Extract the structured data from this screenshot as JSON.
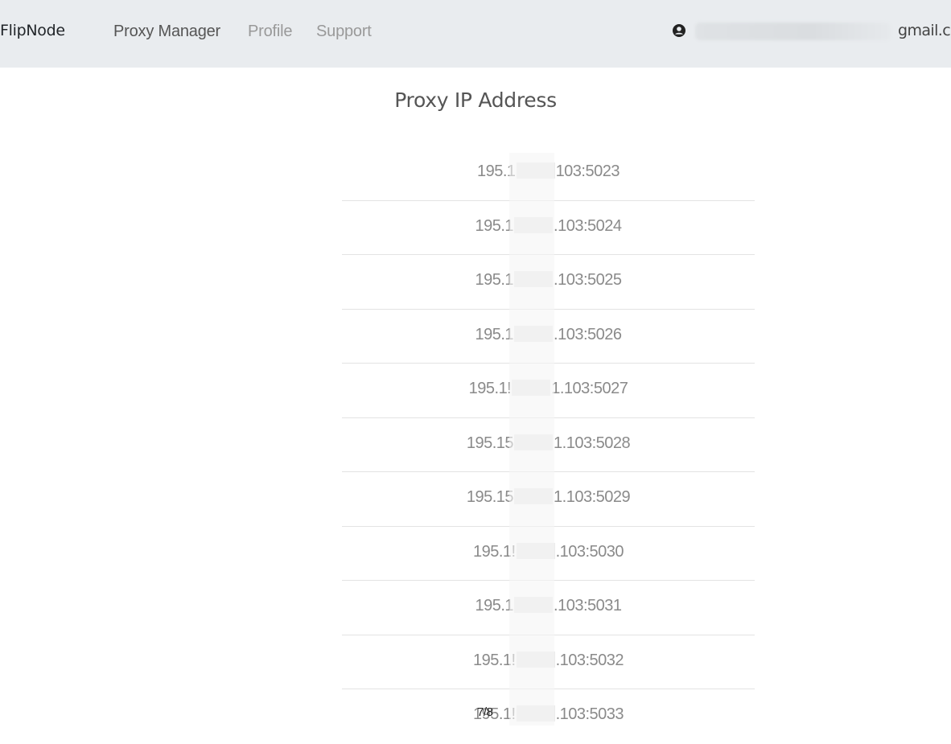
{
  "navbar": {
    "brand": "FlipNode",
    "links": [
      {
        "label": "Proxy Manager",
        "active": true
      },
      {
        "label": "Profile",
        "active": false
      },
      {
        "label": "Support",
        "active": false
      }
    ],
    "user": {
      "icon": "user-circle-icon",
      "email_visible_suffix": "gmail.com"
    }
  },
  "main": {
    "title": "Proxy IP Address",
    "proxies": [
      {
        "prefix": "195.1",
        "suffix": "103:5023"
      },
      {
        "prefix": "195.1",
        "suffix": ".103:5024"
      },
      {
        "prefix": "195.1",
        "suffix": ".103:5025"
      },
      {
        "prefix": "195.1",
        "suffix": ".103:5026"
      },
      {
        "prefix": "195.1!",
        "suffix": "1.103:5027"
      },
      {
        "prefix": "195.15",
        "suffix": "1.103:5028"
      },
      {
        "prefix": "195.15",
        "suffix": "1.103:5029"
      },
      {
        "prefix": "195.1!",
        "suffix": ".103:5030"
      },
      {
        "prefix": "195.1",
        "suffix": ".103:5031"
      },
      {
        "prefix": "195.1!",
        "suffix": ".103:5032"
      },
      {
        "prefix": "195.1!",
        "suffix": ".103:5033"
      }
    ]
  },
  "overlay": {
    "page_indicator": "7/8"
  }
}
